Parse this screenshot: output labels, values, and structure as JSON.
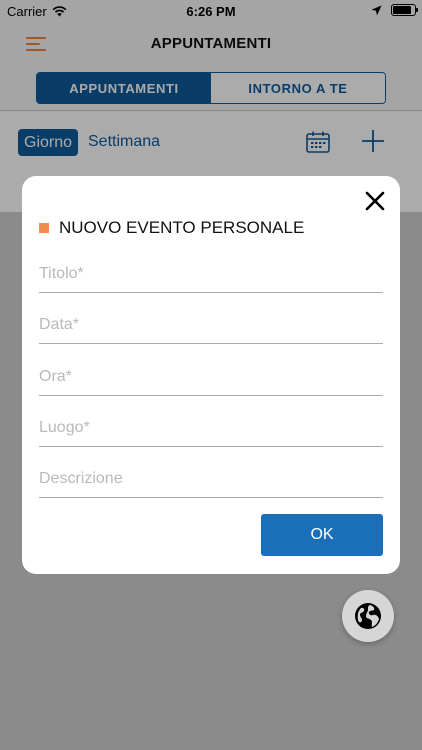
{
  "status_bar": {
    "carrier": "Carrier",
    "time": "6:26 PM",
    "battery_level": 0.85
  },
  "nav": {
    "title": "APPUNTAMENTI",
    "menu_icon": "hamburger-menu-icon"
  },
  "segments": {
    "items": [
      {
        "label": "APPUNTAMENTI",
        "selected": true
      },
      {
        "label": "INTORNO A TE",
        "selected": false
      }
    ]
  },
  "toolbar": {
    "day_label": "Giorno",
    "week_label": "Settimana",
    "calendar_icon": "calendar-icon",
    "add_icon": "plus-icon"
  },
  "modal": {
    "title": "NUOVO EVENTO PERSONALE",
    "title_accent_color": "#f08c4d",
    "fields": [
      {
        "placeholder": "Titolo*",
        "value": ""
      },
      {
        "placeholder": "Data*",
        "value": ""
      },
      {
        "placeholder": "Ora*",
        "value": ""
      },
      {
        "placeholder": "Luogo*",
        "value": ""
      },
      {
        "placeholder": "Descrizione",
        "value": ""
      }
    ],
    "ok_label": "OK",
    "close_icon": "close-icon"
  },
  "fab": {
    "icon": "globe-icon"
  },
  "colors": {
    "primary": "#0f5a9c",
    "ok_button": "#1b6fb9",
    "accent": "#e8853b"
  }
}
